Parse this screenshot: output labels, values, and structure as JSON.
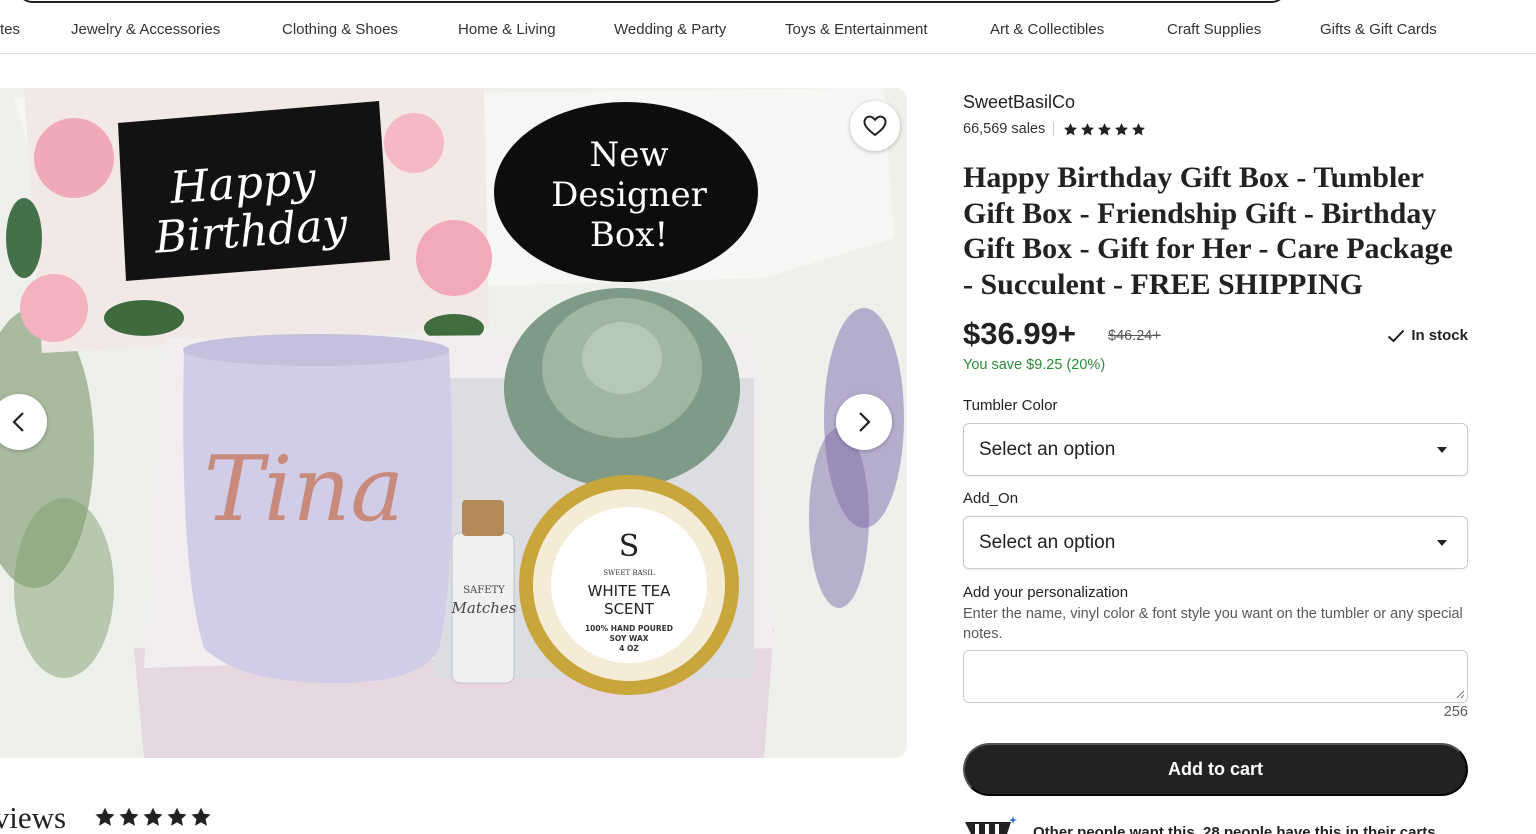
{
  "nav": {
    "categories": [
      {
        "label": "tes"
      },
      {
        "label": "Jewelry & Accessories"
      },
      {
        "label": "Clothing & Shoes"
      },
      {
        "label": "Home & Living"
      },
      {
        "label": "Wedding & Party"
      },
      {
        "label": "Toys & Entertainment"
      },
      {
        "label": "Art & Collectibles"
      },
      {
        "label": "Craft Supplies"
      },
      {
        "label": "Gifts & Gift Cards"
      }
    ]
  },
  "gallery": {
    "card_text": "Happy Birthday",
    "badge_text": "New Designer Box!",
    "tumbler_name": "Tina",
    "matches_label": "SAFETY Matches",
    "candle": {
      "logo": "S",
      "brand": "SWEET BASIL",
      "scent": "WHITE TEA SCENT",
      "detail": "100% HAND POURED SOY WAX",
      "size": "4 OZ"
    },
    "icons": {
      "favorite": "heart-icon",
      "prev": "chevron-left-icon",
      "next": "chevron-right-icon"
    }
  },
  "reviews": {
    "heading": "eviews",
    "rating": 5
  },
  "product": {
    "shop_name": "SweetBasilCo",
    "sales": "66,569 sales",
    "rating": 5,
    "title": "Happy Birthday Gift Box - Tumbler Gift Box - Friendship Gift - Birthday Gift Box - Gift for Her - Care Package - Succulent - FREE SHIPPING",
    "price": "$36.99+",
    "original_price": "$46.24+",
    "stock": "In stock",
    "savings": "You save $9.25 (20%)",
    "options": [
      {
        "label": "Tumbler Color",
        "value": "Select an option"
      },
      {
        "label": "Add_On",
        "value": "Select an option"
      }
    ],
    "personalization": {
      "label": "Add your personalization",
      "hint": "Enter the name, vinyl color & font style you want on the tumbler or any special notes.",
      "value": "",
      "counter": "256"
    },
    "add_to_cart": "Add to cart",
    "demand_text": "Other people want this. 28 people have this in their carts"
  },
  "colors": {
    "accent_dark": "#222222",
    "savings_green": "#2d8a3a",
    "muted": "#595959"
  }
}
